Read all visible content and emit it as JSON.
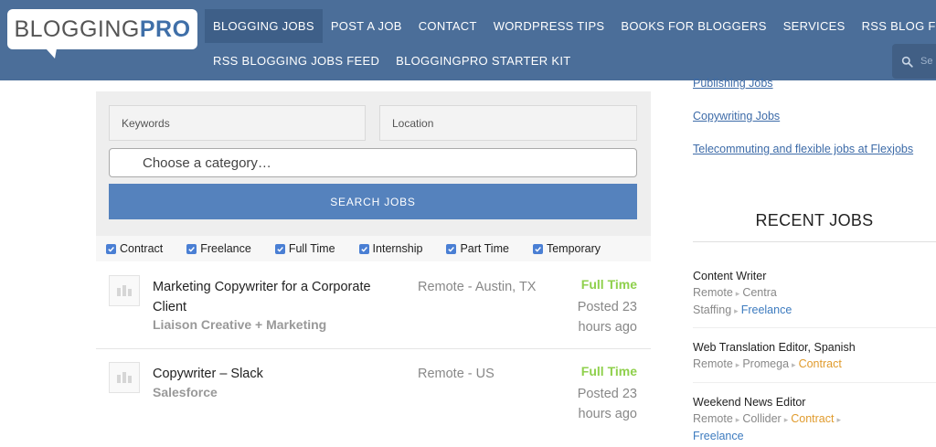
{
  "logo": {
    "part1": "BLOGGING",
    "part2": "PRO"
  },
  "nav": {
    "row1": [
      "BLOGGING JOBS",
      "POST A JOB",
      "CONTACT",
      "WORDPRESS TIPS",
      "BOOKS FOR BLOGGERS",
      "SERVICES",
      "RSS BLOG FEED"
    ],
    "row2": [
      "RSS BLOGGING JOBS FEED",
      "BLOGGINGPRO STARTER KIT"
    ],
    "search_placeholder": "Se"
  },
  "filters": {
    "keywords_placeholder": "Keywords",
    "location_placeholder": "Location",
    "category_placeholder": "Choose a category…",
    "search_button": "SEARCH JOBS",
    "job_types": [
      "Contract",
      "Freelance",
      "Full Time",
      "Internship",
      "Part Time",
      "Temporary"
    ]
  },
  "jobs": [
    {
      "title": "Marketing Copywriter for a Corporate Client",
      "company": "Liaison Creative + Marketing",
      "location": "Remote - Austin, TX",
      "type": "Full Time",
      "posted": "Posted 23 hours ago"
    },
    {
      "title": "Copywriter – Slack",
      "company": "Salesforce",
      "location": "Remote - US",
      "type": "Full Time",
      "posted": "Posted 23 hours ago"
    }
  ],
  "sidebar": {
    "links": [
      "Publishing Jobs",
      "Copywriting Jobs",
      "Telecommuting and flexible jobs at Flexjobs"
    ],
    "recent_heading": "RECENT JOBS",
    "recent_jobs": [
      {
        "title": "Content Writer",
        "meta1": "Remote",
        "meta2": "Centra",
        "meta3": "Staffing",
        "tag": "Freelance"
      },
      {
        "title": "Web Translation Editor, Spanish",
        "meta1": "Remote",
        "meta2": "Promega",
        "tag": "Contract"
      },
      {
        "title": "Weekend News Editor",
        "meta1": "Remote",
        "meta2": "Collider",
        "tag": "Contract",
        "tag2": "Freelance"
      }
    ]
  },
  "colors": {
    "header": "#4b6e99",
    "button": "#5582bd",
    "full_time": "#8fd04c",
    "link": "#3d6ba8",
    "contract": "#e09b2d"
  }
}
